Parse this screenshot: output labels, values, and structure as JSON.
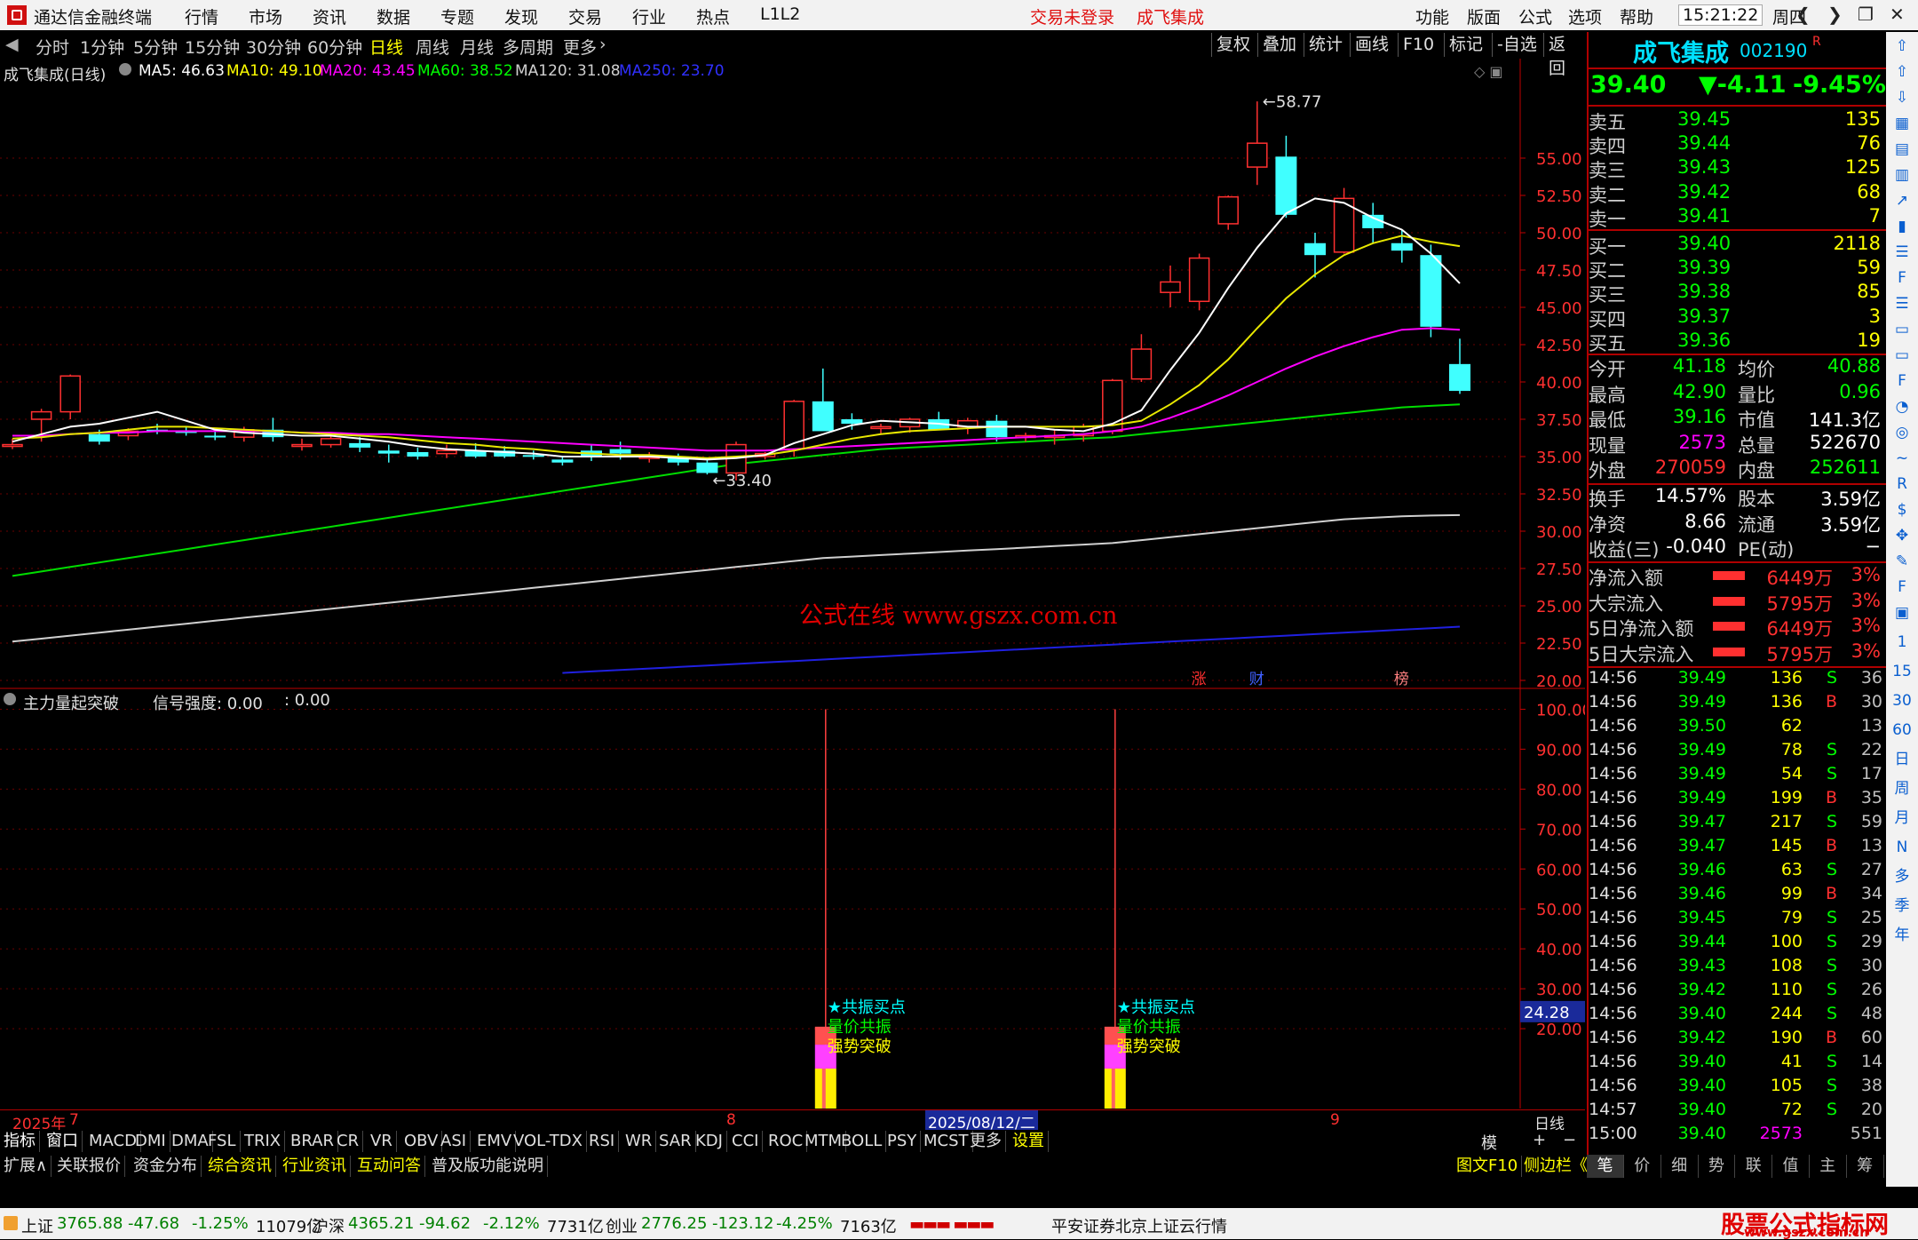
{
  "app": {
    "title": "通达信金融终端",
    "menus": [
      "行情",
      "市场",
      "资讯",
      "数据",
      "专题",
      "发现",
      "交易",
      "行业",
      "热点",
      "L1L2"
    ],
    "login_status": "交易未登录",
    "stock_title": "成飞集成",
    "right_menus": [
      "功能",
      "版面",
      "公式",
      "选项",
      "帮助"
    ],
    "time": "15:21:22",
    "weekday": "周四"
  },
  "periods": [
    "分时",
    "1分钟",
    "5分钟",
    "15分钟",
    "30分钟",
    "60分钟",
    "日线",
    "周线",
    "月线",
    "多周期",
    "更多"
  ],
  "active_period": "日线",
  "chart_buttons": [
    "复权",
    "叠加",
    "统计",
    "画线",
    "F10",
    "标记",
    "-自选",
    "返回"
  ],
  "chart_header": {
    "name": "成飞集成(日线)",
    "ma": [
      {
        "label": "MA5: 46.63",
        "color": "#ffffff"
      },
      {
        "label": "MA10: 49.10",
        "color": "#ffff00"
      },
      {
        "label": "MA20: 43.45",
        "color": "#ff00ff"
      },
      {
        "label": "MA60: 38.52",
        "color": "#00ff00"
      },
      {
        "label": "MA120: 31.08",
        "color": "#d0d0d0"
      },
      {
        "label": "MA250: 23.70",
        "color": "#3030ff"
      }
    ]
  },
  "chart_data": {
    "type": "candlestick",
    "ylim": [
      20,
      60
    ],
    "ticks": [
      "55.00",
      "52.50",
      "50.00",
      "47.50",
      "45.00",
      "42.50",
      "40.00",
      "37.50",
      "35.00",
      "32.50",
      "30.00",
      "27.50",
      "25.00",
      "22.50",
      "20.00"
    ],
    "candles": [
      [
        35.7,
        36.2,
        35.5,
        35.8
      ],
      [
        37.5,
        38.2,
        36.0,
        38.0
      ],
      [
        38.0,
        40.5,
        37.5,
        40.4
      ],
      [
        36.5,
        36.8,
        35.8,
        36.0
      ],
      [
        36.4,
        36.9,
        36.1,
        36.7
      ],
      [
        36.8,
        37.2,
        36.5,
        36.7
      ],
      [
        36.7,
        37.0,
        36.4,
        36.6
      ],
      [
        36.4,
        36.8,
        36.1,
        36.3
      ],
      [
        36.3,
        37.0,
        36.0,
        36.8
      ],
      [
        36.8,
        37.6,
        36.0,
        36.3
      ],
      [
        35.8,
        36.2,
        35.4,
        35.8
      ],
      [
        35.8,
        36.5,
        35.6,
        36.2
      ],
      [
        35.9,
        36.3,
        35.3,
        35.6
      ],
      [
        35.4,
        35.8,
        34.6,
        35.2
      ],
      [
        35.3,
        35.6,
        34.8,
        35.0
      ],
      [
        35.2,
        35.8,
        34.9,
        35.4
      ],
      [
        35.4,
        35.9,
        34.9,
        35.0
      ],
      [
        35.4,
        35.7,
        34.9,
        35.0
      ],
      [
        35.1,
        35.4,
        34.8,
        35.0
      ],
      [
        34.8,
        35.0,
        34.4,
        34.6
      ],
      [
        35.4,
        35.8,
        34.7,
        35.0
      ],
      [
        35.5,
        36.0,
        34.8,
        35.2
      ],
      [
        34.9,
        35.3,
        34.6,
        35.0
      ],
      [
        34.9,
        35.2,
        34.4,
        34.6
      ],
      [
        34.6,
        34.8,
        33.8,
        33.9
      ],
      [
        33.9,
        36.0,
        33.4,
        35.8
      ],
      [
        35.0,
        35.3,
        34.8,
        35.2
      ],
      [
        35.5,
        38.8,
        35.0,
        38.7
      ],
      [
        38.7,
        40.9,
        37.0,
        36.7
      ],
      [
        37.5,
        37.9,
        36.8,
        37.2
      ],
      [
        37.0,
        37.2,
        36.5,
        37.0
      ],
      [
        37.0,
        37.6,
        36.6,
        37.5
      ],
      [
        37.5,
        38.0,
        36.8,
        36.8
      ],
      [
        37.0,
        37.6,
        36.5,
        37.4
      ],
      [
        37.4,
        37.8,
        36.0,
        36.3
      ],
      [
        36.3,
        36.6,
        36.0,
        36.4
      ],
      [
        36.4,
        36.8,
        35.8,
        36.4
      ],
      [
        36.4,
        37.2,
        36.0,
        37.0
      ],
      [
        36.7,
        40.2,
        36.5,
        40.1
      ],
      [
        40.2,
        43.2,
        40.0,
        42.2
      ],
      [
        46.0,
        47.8,
        45.0,
        46.7
      ],
      [
        45.4,
        48.6,
        44.8,
        48.3
      ],
      [
        50.6,
        52.5,
        50.2,
        52.4
      ],
      [
        54.4,
        58.8,
        53.2,
        56.0
      ],
      [
        55.1,
        56.5,
        51.0,
        51.2
      ],
      [
        49.3,
        50.0,
        47.0,
        48.5
      ],
      [
        48.7,
        53.0,
        48.6,
        52.3
      ],
      [
        51.2,
        52.0,
        49.3,
        50.3
      ],
      [
        49.3,
        50.2,
        48.0,
        48.8
      ],
      [
        48.5,
        49.2,
        43.0,
        43.7
      ],
      [
        41.2,
        42.9,
        39.2,
        39.4
      ]
    ],
    "ma5": [
      36.0,
      36.5,
      37.0,
      37.2,
      37.6,
      38.0,
      37.4,
      36.8,
      36.6,
      36.5,
      36.4,
      36.4,
      36.2,
      36.0,
      35.7,
      35.5,
      35.4,
      35.3,
      35.2,
      35.0,
      35.0,
      35.0,
      35.0,
      34.9,
      34.8,
      34.9,
      35.1,
      35.9,
      36.5,
      37.1,
      37.4,
      37.3,
      37.2,
      37.0,
      37.0,
      37.0,
      36.8,
      36.7,
      37.2,
      38.1,
      40.8,
      43.3,
      46.3,
      49.0,
      51.3,
      52.3,
      52.0,
      51.0,
      50.2,
      48.6,
      46.6
    ],
    "ma10": [
      36.2,
      36.3,
      36.5,
      36.6,
      36.8,
      37.0,
      37.0,
      36.9,
      36.8,
      36.7,
      36.6,
      36.5,
      36.4,
      36.3,
      36.1,
      35.9,
      35.8,
      35.6,
      35.5,
      35.3,
      35.2,
      35.1,
      35.1,
      35.0,
      34.9,
      35.0,
      35.1,
      35.4,
      35.8,
      36.2,
      36.5,
      36.7,
      36.8,
      36.9,
      37.0,
      37.0,
      37.0,
      37.0,
      37.1,
      37.4,
      38.5,
      39.8,
      41.5,
      43.6,
      45.6,
      47.2,
      48.5,
      49.3,
      49.8,
      49.4,
      49.1
    ],
    "ma20": [
      36.4,
      36.4,
      36.5,
      36.6,
      36.6,
      36.7,
      36.7,
      36.7,
      36.7,
      36.7,
      36.6,
      36.6,
      36.5,
      36.5,
      36.4,
      36.3,
      36.2,
      36.1,
      36.0,
      35.9,
      35.8,
      35.7,
      35.6,
      35.5,
      35.4,
      35.4,
      35.4,
      35.5,
      35.6,
      35.7,
      35.8,
      35.9,
      36.0,
      36.1,
      36.2,
      36.3,
      36.4,
      36.5,
      36.7,
      37.0,
      37.6,
      38.3,
      39.1,
      40.0,
      40.9,
      41.7,
      42.4,
      43.0,
      43.5,
      43.6,
      43.5
    ],
    "ma60": [
      27.0,
      27.3,
      27.6,
      27.9,
      28.2,
      28.5,
      28.8,
      29.1,
      29.4,
      29.7,
      30.0,
      30.3,
      30.6,
      30.9,
      31.2,
      31.5,
      31.8,
      32.1,
      32.4,
      32.7,
      33.0,
      33.3,
      33.6,
      33.9,
      34.2,
      34.5,
      34.7,
      34.9,
      35.1,
      35.3,
      35.5,
      35.6,
      35.7,
      35.8,
      35.9,
      36.0,
      36.1,
      36.2,
      36.3,
      36.5,
      36.7,
      36.9,
      37.1,
      37.3,
      37.5,
      37.7,
      37.9,
      38.1,
      38.3,
      38.4,
      38.5
    ],
    "ma120": [
      22.6,
      22.8,
      23.0,
      23.2,
      23.4,
      23.6,
      23.8,
      24.0,
      24.2,
      24.4,
      24.6,
      24.8,
      25.0,
      25.2,
      25.4,
      25.6,
      25.8,
      26.0,
      26.2,
      26.4,
      26.6,
      26.8,
      27.0,
      27.2,
      27.4,
      27.6,
      27.8,
      28.0,
      28.2,
      28.3,
      28.4,
      28.5,
      28.6,
      28.7,
      28.8,
      28.9,
      29.0,
      29.1,
      29.2,
      29.4,
      29.6,
      29.8,
      30.0,
      30.2,
      30.4,
      30.6,
      30.8,
      30.9,
      31.0,
      31.05,
      31.08
    ],
    "ma250_start_index": 19,
    "ma250": [
      20.5,
      20.6,
      20.7,
      20.8,
      20.9,
      21.0,
      21.1,
      21.2,
      21.3,
      21.4,
      21.5,
      21.6,
      21.7,
      21.8,
      21.9,
      22.0,
      22.1,
      22.2,
      22.3,
      22.4,
      22.5,
      22.6,
      22.7,
      22.8,
      22.9,
      23.0,
      23.1,
      23.2,
      23.3,
      23.4,
      23.5,
      23.6
    ],
    "annotations": [
      {
        "text": "58.77",
        "index": 43,
        "price": 58.77
      },
      {
        "text": "33.40",
        "index": 24,
        "price": 33.4
      }
    ],
    "watermark": "公式在线  www.gszx.com.cn",
    "markers": [
      {
        "text": "涨",
        "index": 41,
        "color": "#ff3030"
      },
      {
        "text": "财",
        "index": 43,
        "color": "#4060ff"
      },
      {
        "text": "榜",
        "index": 48,
        "color": "#ff8080"
      }
    ]
  },
  "sub_chart": {
    "title": "主力量起突破",
    "signal_label": "信号强度: 0.00",
    "signal_extra": ": 0.00",
    "ticks": [
      "100.00",
      "90.00",
      "80.00",
      "70.00",
      "60.00",
      "50.00",
      "40.00",
      "30.00",
      "20.00"
    ],
    "ylim": [
      0,
      105
    ],
    "current_value": "24.28",
    "signals": [
      {
        "index": 28,
        "labels": [
          "★共振买点",
          "量价共振",
          "强势突破"
        ]
      },
      {
        "index": 38,
        "labels": [
          "★共振买点",
          "量价共振",
          "强势突破"
        ]
      }
    ]
  },
  "xaxis": {
    "year_label": "2025年",
    "m7": "7",
    "m8": "8",
    "cursor_date": "2025/08/12/二",
    "m9": "9",
    "period": "日线"
  },
  "indicator_tabs": [
    "指标",
    "窗口",
    "MACD",
    "DMI",
    "DMA",
    "FSL",
    "TRIX",
    "BRAR",
    "CR",
    "VR",
    "OBV",
    "ASI",
    "EMV",
    "VOL-TDX",
    "RSI",
    "WR",
    "SAR",
    "KDJ",
    "CCI",
    "ROC",
    "MTM",
    "BOLL",
    "PSY",
    "MCST",
    "更多",
    "设置"
  ],
  "tabs_right": [
    "模板",
    "+",
    "−"
  ],
  "info_tabs": [
    "扩展∧",
    "关联报价",
    "资金分布",
    "综合资讯",
    "行业资讯",
    "互动问答",
    "普及版功能说明"
  ],
  "info_right": [
    "图文F10",
    "侧边栏《"
  ],
  "panel": {
    "name": "成飞集成",
    "code": "002190",
    "r_mark": "R",
    "price": "39.40",
    "change": "▼-4.11",
    "pct": "-9.45%",
    "asks": [
      {
        "label": "卖五",
        "price": "39.45",
        "vol": "135"
      },
      {
        "label": "卖四",
        "price": "39.44",
        "vol": "76"
      },
      {
        "label": "卖三",
        "price": "39.43",
        "vol": "125"
      },
      {
        "label": "卖二",
        "price": "39.42",
        "vol": "68"
      },
      {
        "label": "卖一",
        "price": "39.41",
        "vol": "7"
      }
    ],
    "bids": [
      {
        "label": "买一",
        "price": "39.40",
        "vol": "2118"
      },
      {
        "label": "买二",
        "price": "39.39",
        "vol": "59"
      },
      {
        "label": "买三",
        "price": "39.38",
        "vol": "85"
      },
      {
        "label": "买四",
        "price": "39.37",
        "vol": "3"
      },
      {
        "label": "买五",
        "price": "39.36",
        "vol": "19"
      }
    ],
    "stats": [
      {
        "l1": "今开",
        "v1": "41.18",
        "c1": "#00ff00",
        "l2": "均价",
        "v2": "40.88",
        "c2": "#00ff00"
      },
      {
        "l1": "最高",
        "v1": "42.90",
        "c1": "#00ff00",
        "l2": "量比",
        "v2": "0.96",
        "c2": "#00ff00"
      },
      {
        "l1": "最低",
        "v1": "39.16",
        "c1": "#00ff00",
        "l2": "市值",
        "v2": "141.3亿",
        "c2": "#ffffff"
      },
      {
        "l1": "现量",
        "v1": "2573",
        "c1": "#ff00ff",
        "l2": "总量",
        "v2": "522670",
        "c2": "#ffffff"
      },
      {
        "l1": "外盘",
        "v1": "270059",
        "c1": "#ff3030",
        "l2": "内盘",
        "v2": "252611",
        "c2": "#00ff00"
      }
    ],
    "stats2": [
      {
        "l1": "换手",
        "v1": "14.57%",
        "l2": "股本",
        "v2": "3.59亿"
      },
      {
        "l1": "净资",
        "v1": "8.66",
        "l2": "流通",
        "v2": "3.59亿"
      },
      {
        "l1": "收益(三)",
        "v1": "-0.040",
        "l2": "PE(动)",
        "v2": "−"
      }
    ],
    "flows": [
      {
        "label": "净流入额",
        "value": "6449万",
        "pct": "3%"
      },
      {
        "label": "大宗流入",
        "value": "5795万",
        "pct": "3%"
      },
      {
        "label": "5日净流入额",
        "value": "6449万",
        "pct": "3%"
      },
      {
        "label": "5日大宗流入",
        "value": "5795万",
        "pct": "3%"
      }
    ],
    "ticks": [
      [
        "14:56",
        "39.49",
        "136",
        "S",
        "36"
      ],
      [
        "14:56",
        "39.49",
        "136",
        "B",
        "30"
      ],
      [
        "14:56",
        "39.50",
        "62",
        "",
        ""
      ],
      [
        "14:56",
        "39.49",
        "78",
        "S",
        "22"
      ],
      [
        "14:56",
        "39.49",
        "54",
        "S",
        "17"
      ],
      [
        "14:56",
        "39.49",
        "199",
        "B",
        "35"
      ],
      [
        "14:56",
        "39.47",
        "217",
        "S",
        "59"
      ],
      [
        "14:56",
        "39.47",
        "145",
        "B",
        "13"
      ],
      [
        "14:56",
        "39.46",
        "63",
        "S",
        "27"
      ],
      [
        "14:56",
        "39.46",
        "99",
        "B",
        "34"
      ],
      [
        "14:56",
        "39.45",
        "79",
        "S",
        "25"
      ],
      [
        "14:56",
        "39.44",
        "100",
        "S",
        "29"
      ],
      [
        "14:56",
        "39.43",
        "108",
        "S",
        "30"
      ],
      [
        "14:56",
        "39.42",
        "110",
        "S",
        "26"
      ],
      [
        "14:56",
        "39.40",
        "244",
        "S",
        "48"
      ],
      [
        "14:56",
        "39.42",
        "190",
        "B",
        "60"
      ],
      [
        "14:56",
        "39.40",
        "41",
        "S",
        "14"
      ],
      [
        "14:56",
        "39.40",
        "105",
        "S",
        "38"
      ],
      [
        "14:57",
        "39.40",
        "72",
        "S",
        "20"
      ],
      [
        "15:00",
        "39.40",
        "2573",
        "",
        "551"
      ]
    ],
    "tick_col3_overrides": {
      "2": "13"
    },
    "bottom_tabs": [
      "笔",
      "价",
      "细",
      "势",
      "联",
      "值",
      "主",
      "筹"
    ]
  },
  "sidebar_icons": [
    "up",
    "up",
    "down",
    "grid",
    "chart",
    "bars",
    "trend",
    "k",
    "list",
    "F10",
    "list",
    "doc",
    "doc",
    "F5",
    "pie",
    "eye",
    "rsi",
    "RSI",
    "s",
    "move",
    "pen",
    "F5",
    "img",
    "1",
    "15",
    "30",
    "60",
    "日",
    "周",
    "月",
    "N",
    "多",
    "季",
    "年"
  ],
  "status": {
    "items": [
      {
        "name": "上证",
        "val": "3765.88",
        "chg": "-47.68",
        "pct": "-1.25%",
        "amt": "11079亿"
      },
      {
        "name": "沪深",
        "val": "4365.21",
        "chg": "-94.62",
        "pct": "-2.12%",
        "amt": "7731亿"
      },
      {
        "name": "创业",
        "val": "2776.25",
        "chg": "-123.12",
        "pct": "-4.25%",
        "amt": "7163亿"
      }
    ],
    "server": "平安证券北京上证云行情",
    "brand": "股票公式指标网",
    "brand_url": "www.gszx.com.cn"
  }
}
